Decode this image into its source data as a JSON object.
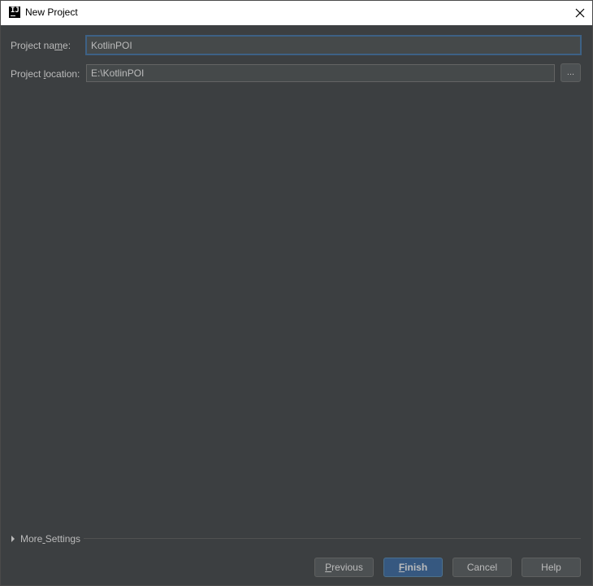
{
  "window": {
    "title": "New Project",
    "app_icon_text": "IJ"
  },
  "form": {
    "project_name_label_pre": "Project na",
    "project_name_label_mnemonic": "m",
    "project_name_label_post": "e:",
    "project_name_value": "KotlinPOI",
    "project_location_label_pre": "Project ",
    "project_location_label_mnemonic": "l",
    "project_location_label_post": "ocation:",
    "project_location_value": "E:\\KotlinPOI",
    "browse_label": "..."
  },
  "more_settings": {
    "label_pre": "More",
    "label_mnemonic": " ",
    "label_post": "Settings",
    "expanded": false
  },
  "buttons": {
    "previous_mnemonic": "P",
    "previous_rest": "revious",
    "finish_mnemonic": "F",
    "finish_rest": "inish",
    "cancel": "Cancel",
    "help": "Help"
  },
  "colors": {
    "background": "#3c3f41",
    "field_background": "#45494a",
    "text": "#bbbbbb",
    "primary_button": "#365880",
    "focus_border": "#3d6185"
  }
}
